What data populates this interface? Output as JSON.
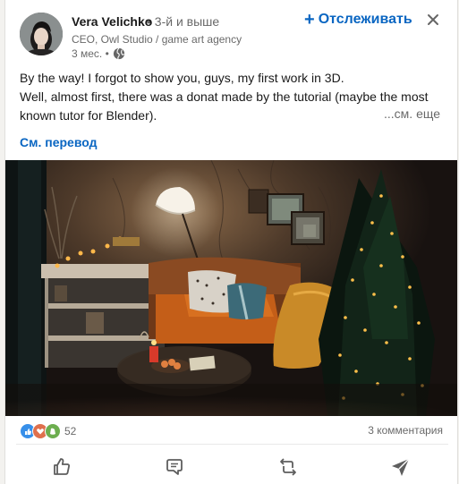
{
  "post": {
    "author": {
      "name": "Vera Velichko",
      "degree": "• 3-й и выше",
      "headline": "CEO, Owl Studio / game art agency",
      "time": "3 мес. •"
    },
    "follow_label": "Отслеживать",
    "text_lines": [
      "By the way! I forgot to show you, guys, my first work in 3D.",
      "Well, almost first, there was a donat made by the tutorial (maybe the most",
      "known tutor for Blender)."
    ],
    "see_more": "...см. еще",
    "translate_label": "См. перевод"
  },
  "social": {
    "reactions_count": "52",
    "comments_label": "3 комментария"
  },
  "actions": [
    "like-icon",
    "comment-icon",
    "repost-icon",
    "send-icon"
  ],
  "colors": {
    "accent": "#0a66c2",
    "like": "#378fe9",
    "love": "#df704d",
    "celebrate": "#6dae4f"
  }
}
